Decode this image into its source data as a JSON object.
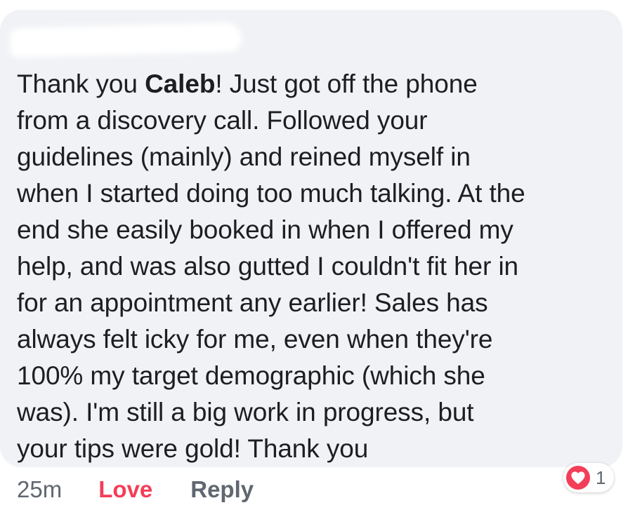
{
  "comment": {
    "author_blurred": true,
    "text_before_mention": "Thank you ",
    "mention": "Caleb",
    "lines": [
      "! Just got off the phone",
      "from a discovery call. Followed your",
      "guidelines (mainly) and reined myself in",
      "when I started doing too much talking. At the",
      "end she easily booked in when I offered my",
      "help, and was also gutted I couldn't fit her in",
      "for an appointment any earlier! Sales has",
      "always felt icky for me, even when they're",
      "100% my target demographic (which she",
      "was). I'm still a big work in progress, but",
      "your tips were gold! Thank you"
    ]
  },
  "actions": {
    "timestamp": "25m",
    "love_label": "Love",
    "reply_label": "Reply"
  },
  "reactions": {
    "icon": "love-heart-icon",
    "count": "1"
  },
  "colors": {
    "bubble": "#f0f2f5",
    "text": "#1c1e21",
    "love": "#f33e58",
    "muted": "#606770"
  }
}
